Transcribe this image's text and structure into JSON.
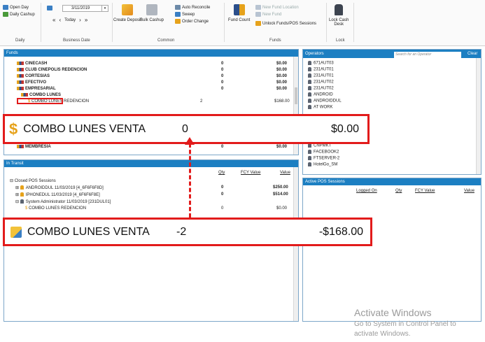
{
  "ribbon": {
    "daily": {
      "open_day": "Open Day",
      "daily_cashup": "Daily Cashup",
      "label": "Daily"
    },
    "business_date": {
      "date": "3/11/2019",
      "today": "Today",
      "label": "Business Date",
      "first": "«",
      "prev": "‹",
      "next": "›",
      "last": "»"
    },
    "common": {
      "create_deposit": "Create Deposit",
      "bulk_cashup": "Bulk Cashup",
      "auto_reconcile": "Auto Reconcile",
      "sweep": "Sweep",
      "order_change": "Order Change",
      "label": "Common"
    },
    "funds": {
      "fund_count": "Fund Count",
      "new_fund_location": "New Fund Location",
      "new_fund": "New Fund",
      "unlock_funds": "Unlock Funds/POS Sessions",
      "label": "Funds"
    },
    "lock": {
      "lock_cash_desk_line1": "Lock Cash",
      "lock_cash_desk_line2": "Desk",
      "label": "Lock"
    }
  },
  "funds_panel": {
    "title": "Funds",
    "rows": [
      {
        "name": "CINECASH",
        "qty": "0",
        "value": "$0.00"
      },
      {
        "name": "CLUB CINEPOLIS REDENCION",
        "qty": "0",
        "value": "$0.00"
      },
      {
        "name": "CORTESIAS",
        "qty": "0",
        "value": "$0.00"
      },
      {
        "name": "EFECTIVO",
        "qty": "0",
        "value": "$0.00"
      },
      {
        "name": "EMPRESARIAL",
        "qty": "0",
        "value": "$0.00"
      },
      {
        "name": "COMBO LUNES",
        "qty": "",
        "value": ""
      },
      {
        "name": "COMBO LUNES REDENCION",
        "qty": "2",
        "value": "$168.00"
      }
    ],
    "membresia": {
      "name": "MEMBRESIA",
      "qty": "0",
      "value": "$0.00"
    }
  },
  "callout_top": {
    "name": "COMBO LUNES VENTA",
    "qty": "0",
    "value": "$0.00"
  },
  "callout_bottom": {
    "name": "COMBO LUNES VENTA",
    "qty": "-2",
    "value": "-$168.00"
  },
  "intransit_panel": {
    "title": "In Transit",
    "col_qty": "Qty",
    "col_fcy": "FCY Value",
    "col_value": "Value",
    "closed_sessions": "Closed POS Sessions",
    "rows": [
      {
        "label": "ANDROIDDUL 11/03/2019 [4_6F6F6F8D]",
        "qty": "0",
        "value": "$250.00"
      },
      {
        "label": "IPHONEDUL 11/03/2019 [4_6F6F6F8E]",
        "qty": "0",
        "value": "$514.00"
      },
      {
        "label": "System Administrator 11/03/2019 [231DUL01]",
        "qty": "",
        "value": ""
      },
      {
        "label": "COMBO LUNES REDENCION",
        "qty": "0",
        "value": "$0.00"
      }
    ]
  },
  "operators_panel": {
    "title": "Operators",
    "search_placeholder": "Search for an Operator",
    "clear": "Clear",
    "items": [
      "671AUT03",
      "231AUT01",
      "231AUT01",
      "231AUT02",
      "231AUT02",
      "ANDROID",
      "ANDROIDDUL",
      "AT WORK",
      "CNPMKT",
      "FACEBOOK2",
      "FTSERVER-2",
      "HotelGo_SM"
    ]
  },
  "active_sessions_panel": {
    "title": "Active POS Sessions",
    "col_logged_on": "Logged On",
    "col_qty": "Qty",
    "col_fcy": "FCY Value",
    "col_value": "Value"
  },
  "watermark": {
    "line1": "Activate Windows",
    "line2": "Go to System in Control Panel to",
    "line3": "activate Windows."
  },
  "colors": {
    "header_blue": "#1c7fc2",
    "callout_red": "#e21b1b"
  }
}
